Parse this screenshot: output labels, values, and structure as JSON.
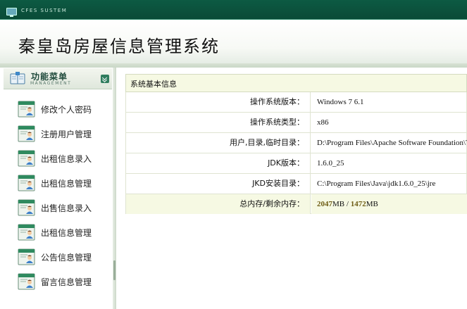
{
  "topbar": {
    "system_name": "CFES SUSTEM"
  },
  "header": {
    "title": "秦皇岛房屋信息管理系统"
  },
  "menu": {
    "title": "功能菜单",
    "subtitle": "MANAGEMENT",
    "items": [
      {
        "label": "修改个人密码"
      },
      {
        "label": "注册用户管理"
      },
      {
        "label": "出租信息录入"
      },
      {
        "label": "出租信息管理"
      },
      {
        "label": "出售信息录入"
      },
      {
        "label": "出租信息管理"
      },
      {
        "label": "公告信息管理"
      },
      {
        "label": "留言信息管理"
      }
    ]
  },
  "info": {
    "section_title": "系统基本信息",
    "rows": [
      {
        "label": "操作系统版本：",
        "value": "Windows 7  6.1"
      },
      {
        "label": "操作系统类型：",
        "value": "x86"
      },
      {
        "label": "用户,目录,临时目录：",
        "value": "D:\\Program Files\\Apache Software Foundation\\Tomcat"
      },
      {
        "label": "JDK版本：",
        "value": "1.6.0_25"
      },
      {
        "label": "JKD安装目录：",
        "value": "C:\\Program Files\\Java\\jdk1.6.0_25\\jre"
      }
    ],
    "memory": {
      "label": "总内存/剩余内存：",
      "total": "2047",
      "total_unit": "MB",
      "separator": " / ",
      "free": "1472",
      "free_unit": "MB"
    }
  },
  "colors": {
    "topbar_bg": "#0d5a43",
    "menu_accent": "#2f7d5e",
    "table_header_bg": "#f6f9e3",
    "memory_number": "#6e5d14"
  },
  "icons": {
    "system": "monitor-icon",
    "menu_header": "menu-book-icon",
    "menu_collapse": "double-chevron-down-icon",
    "menu_item": "user-card-icon"
  }
}
